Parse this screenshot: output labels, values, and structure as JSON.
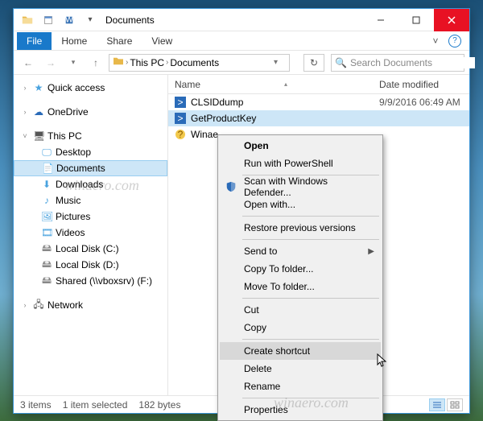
{
  "titlebar": {
    "title": "Documents"
  },
  "ribbon": {
    "file": "File",
    "tabs": [
      "Home",
      "Share",
      "View"
    ]
  },
  "breadcrumb": {
    "root": "This PC",
    "current": "Documents"
  },
  "search": {
    "placeholder": "Search Documents"
  },
  "sidebar": {
    "quick_access": "Quick access",
    "onedrive": "OneDrive",
    "this_pc": "This PC",
    "children": [
      {
        "label": "Desktop"
      },
      {
        "label": "Documents"
      },
      {
        "label": "Downloads"
      },
      {
        "label": "Music"
      },
      {
        "label": "Pictures"
      },
      {
        "label": "Videos"
      },
      {
        "label": "Local Disk (C:)"
      },
      {
        "label": "Local Disk (D:)"
      },
      {
        "label": "Shared (\\\\vboxsrv) (F:)"
      }
    ],
    "network": "Network"
  },
  "list": {
    "cols": {
      "name": "Name",
      "date": "Date modified"
    },
    "rows": [
      {
        "name": "CLSIDdump",
        "date": "9/9/2016 06:49 AM",
        "icon": "ps"
      },
      {
        "name": "GetProductKey",
        "date": "",
        "icon": "ps"
      },
      {
        "name": "Winae",
        "date": "",
        "icon": "chm"
      }
    ]
  },
  "context_menu": {
    "items": [
      {
        "label": "Open",
        "bold": true
      },
      {
        "label": "Run with PowerShell"
      },
      {
        "sep": true
      },
      {
        "label": "Scan with Windows Defender...",
        "icon": "shield"
      },
      {
        "label": "Open with..."
      },
      {
        "sep": true
      },
      {
        "label": "Restore previous versions"
      },
      {
        "sep": true
      },
      {
        "label": "Send to",
        "submenu": true
      },
      {
        "label": "Copy To folder..."
      },
      {
        "label": "Move To folder..."
      },
      {
        "sep": true
      },
      {
        "label": "Cut"
      },
      {
        "label": "Copy"
      },
      {
        "sep": true
      },
      {
        "label": "Create shortcut",
        "hover": true
      },
      {
        "label": "Delete"
      },
      {
        "label": "Rename"
      },
      {
        "sep": true
      },
      {
        "label": "Properties"
      }
    ]
  },
  "statusbar": {
    "count": "3 items",
    "selected": "1 item selected",
    "size": "182 bytes"
  },
  "watermark": "winaero.com"
}
